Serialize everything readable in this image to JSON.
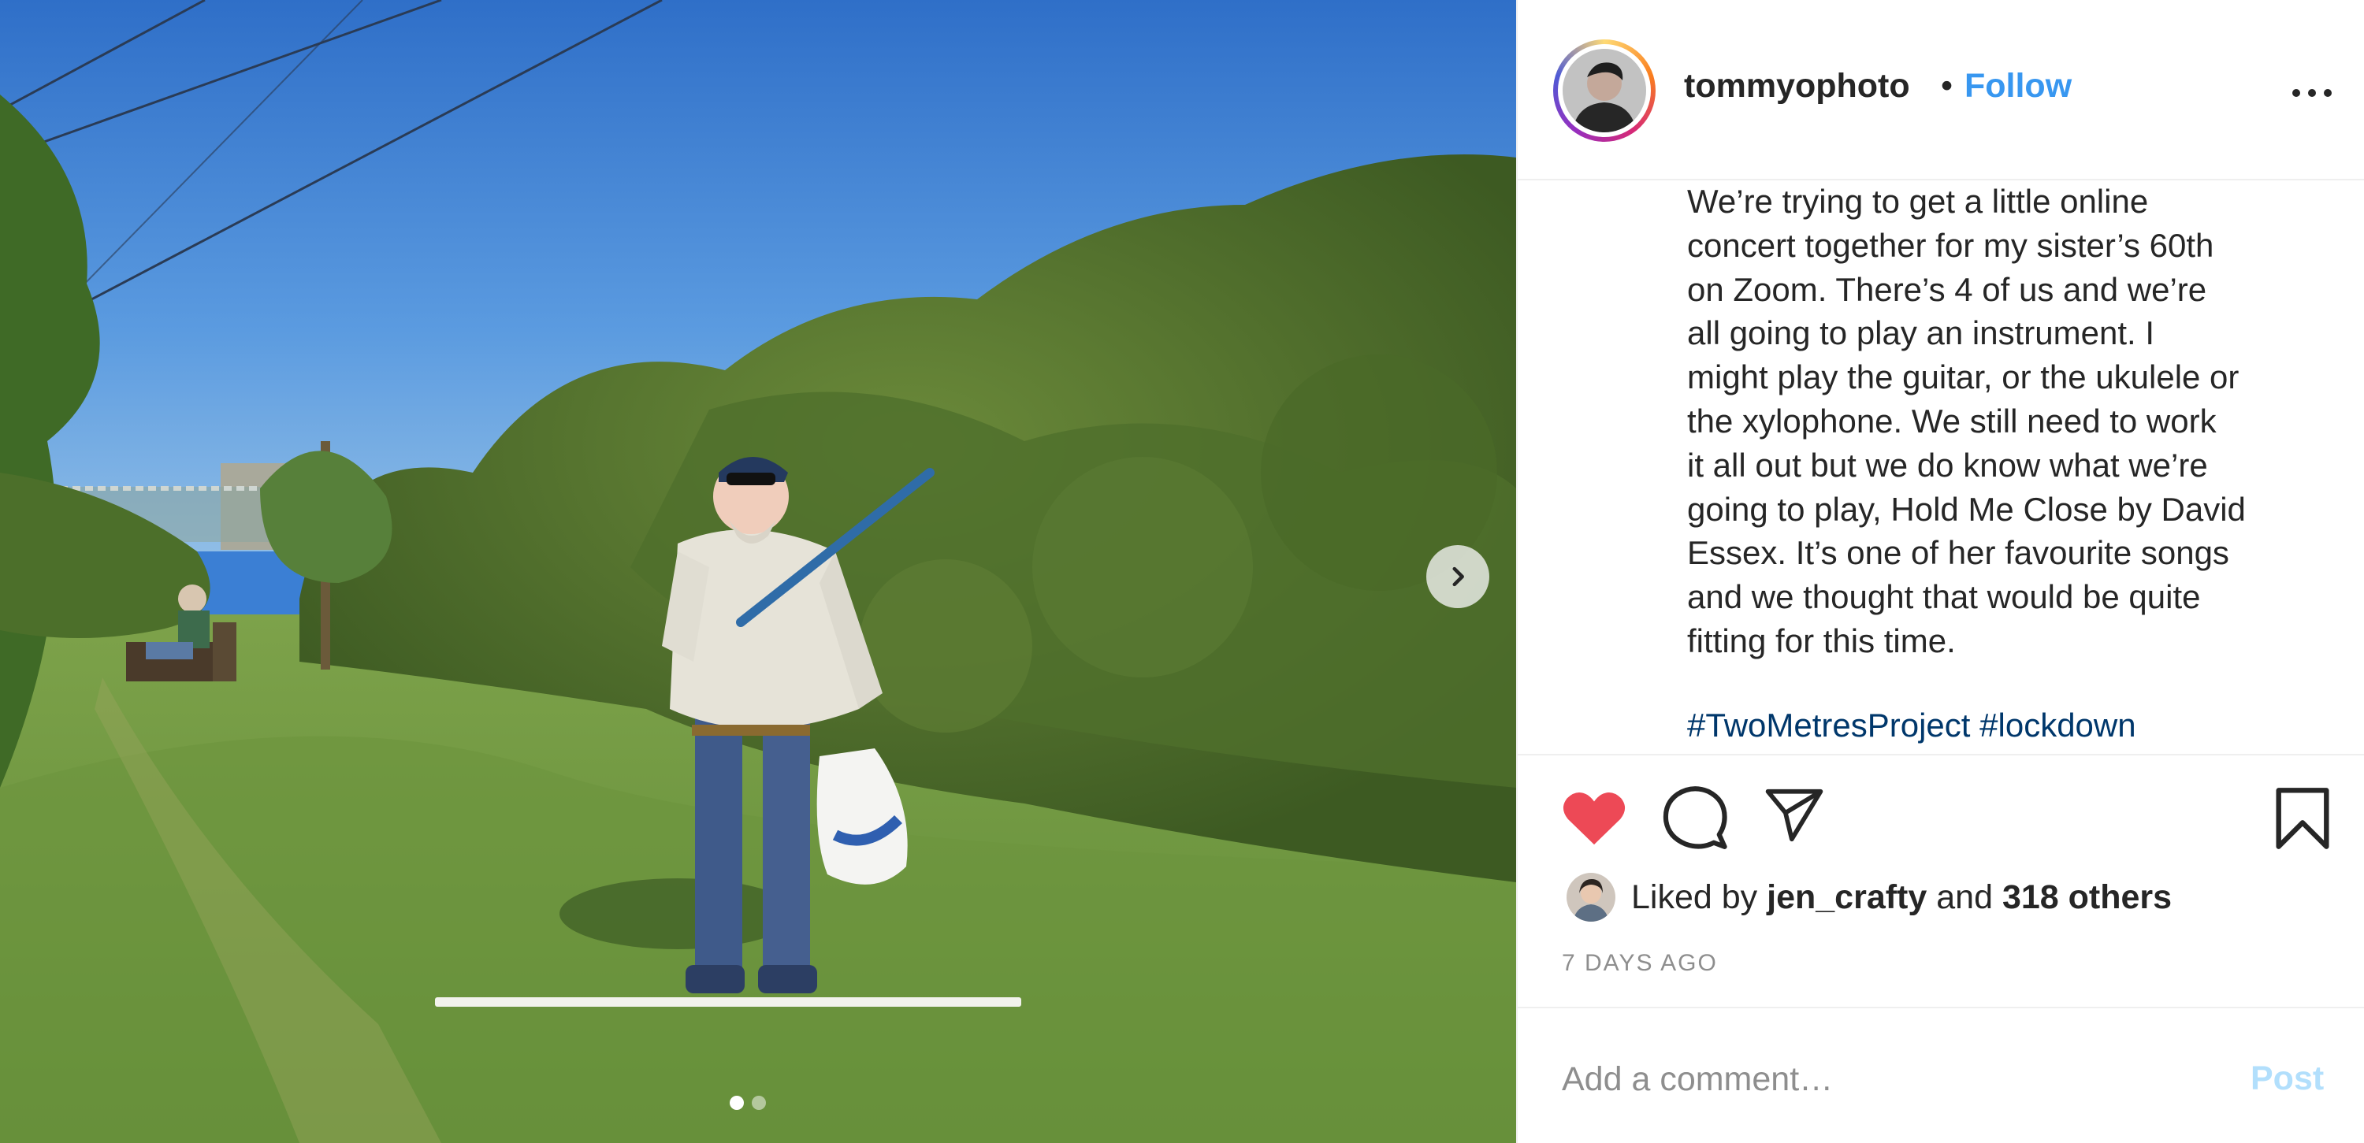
{
  "post": {
    "photo": {
      "description_icon": "photo",
      "carousel": {
        "current": 1,
        "total": 2
      },
      "next_icon": "chevron-right-icon"
    },
    "header": {
      "username": "tommyophoto",
      "separator": "•",
      "follow_label": "Follow",
      "more_icon": "more-horizontal-icon"
    },
    "caption": {
      "text": "We’re trying to get a little online\nconcert together for my sister’s 60th\non Zoom. There’s 4 of us and we’re\nall going to play an instrument. I\nmight play the guitar, or the ukulele or\nthe xylophone. We still need to work\nit all out but we do know what we’re\ngoing to play, Hold Me Close by David\nEssex. It’s one of her favourite songs\nand we thought that would be quite\nfitting for this time.",
      "hashtags": [
        "#TwoMetresProject",
        "#lockdown"
      ]
    },
    "actions": {
      "like_icon": "heart-filled-icon",
      "comment_icon": "comment-icon",
      "share_icon": "paper-plane-icon",
      "save_icon": "bookmark-icon",
      "like_color": "#ed4956"
    },
    "likes": {
      "prefix": "Liked by",
      "first_user": "jen_crafty",
      "conjunction": "and",
      "others": "318 others"
    },
    "timestamp": "7 DAYS AGO",
    "comment": {
      "placeholder": "Add a comment…",
      "value": "",
      "post_label": "Post"
    },
    "colors": {
      "link_blue": "#3897f0",
      "hashtag": "#00376b",
      "muted": "#8e8e8e",
      "post_disabled": "#b2dffc"
    }
  }
}
